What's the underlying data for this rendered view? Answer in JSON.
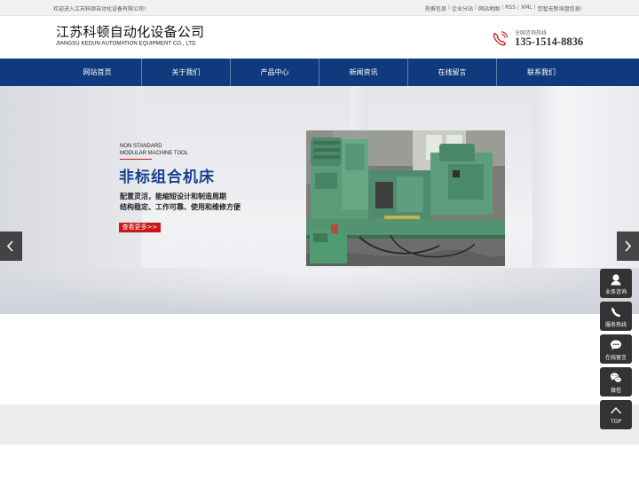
{
  "topbar": {
    "welcome": "欢迎进入江苏科顿自动化设备有限公司!",
    "links": [
      "热推信息",
      "企业分站",
      "网站地图",
      "RSS",
      "XML"
    ],
    "notice": "您暂无新询盘信息!"
  },
  "header": {
    "logo_cn": "江苏科顿自动化设备公司",
    "logo_en": "JIANGSU KEDUN AUTOMATION EQUIPMENT CO., LTD",
    "hotline_label": "全国咨询热线",
    "hotline_number": "135-1514-8836"
  },
  "nav": {
    "items": [
      "网站首页",
      "关于我们",
      "产品中心",
      "新闻资讯",
      "在线留言",
      "联系我们"
    ]
  },
  "banner": {
    "en_line1": "NON STANDARD",
    "en_line2": "MODULAR MACHINE TOOL",
    "title": "非标组合机床",
    "desc_line1": "配置灵活，能缩短设计和制造周期",
    "desc_line2": "结构稳定、工作可靠、使用和维修方便",
    "more_label": "查看更多>>"
  },
  "side_buttons": [
    {
      "label": "业务咨询",
      "icon": "user-icon"
    },
    {
      "label": "服务热线",
      "icon": "phone-icon"
    },
    {
      "label": "在线留言",
      "icon": "chat-bubble-icon"
    },
    {
      "label": "微信",
      "icon": "wechat-icon"
    },
    {
      "label": "TOP",
      "icon": "chevron-up-icon"
    }
  ],
  "colors": {
    "nav_bg": "#0f3a7e",
    "title_blue": "#16418e",
    "accent_red": "#c81818",
    "side_btn_bg": "#333333"
  }
}
